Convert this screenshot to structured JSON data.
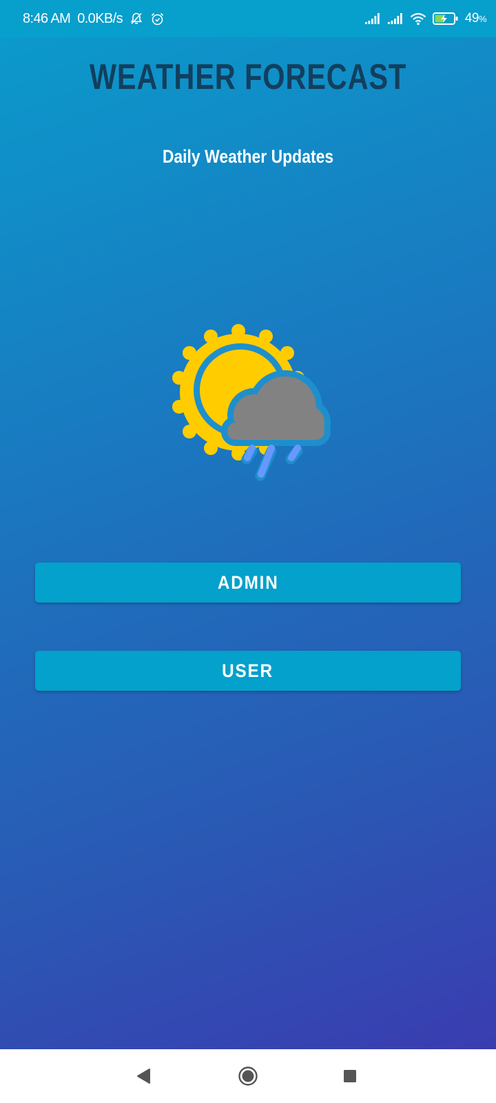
{
  "status_bar": {
    "time": "8:46 AM",
    "net_speed": "0.0KB/s",
    "battery_percent": "49",
    "battery_unit": "%",
    "icons": [
      "bell-off-icon",
      "alarm-icon",
      "signal-icon",
      "signal-icon",
      "wifi-icon",
      "battery-charging-icon"
    ]
  },
  "header": {
    "title": "WEATHER FORECAST",
    "subtitle": "Daily Weather Updates"
  },
  "hero": {
    "icon": "sun-cloud-rain-icon"
  },
  "buttons": {
    "admin_label": "ADMIN",
    "user_label": "USER"
  },
  "nav_bar": {
    "icons": [
      "back-icon",
      "home-icon",
      "recents-icon"
    ]
  },
  "colors": {
    "status_bar": "#079fcc",
    "gradient_top": "#0a9ccc",
    "gradient_bottom": "#3a3cb0",
    "title": "#123f5e",
    "button": "#03a1cb",
    "sun": "#ffcc00",
    "cloud": "#828282",
    "rain": "#6699ff"
  }
}
